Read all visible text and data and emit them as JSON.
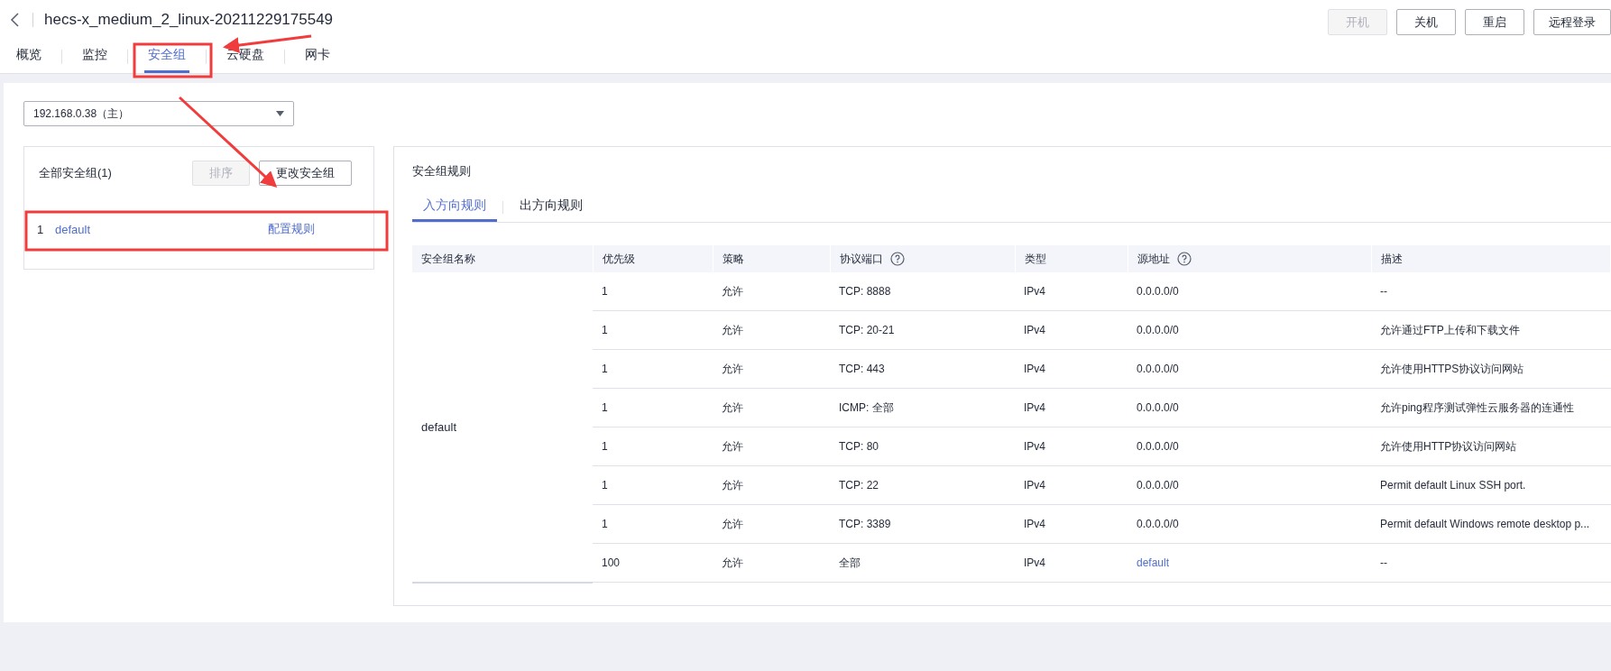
{
  "header": {
    "title": "hecs-x_medium_2_linux-20211229175549",
    "actions": [
      {
        "label": "开机",
        "disabled": true
      },
      {
        "label": "关机",
        "disabled": false
      },
      {
        "label": "重启",
        "disabled": false
      },
      {
        "label": "远程登录",
        "disabled": false
      }
    ]
  },
  "tabs": [
    {
      "label": "概览",
      "selected": false
    },
    {
      "label": "监控",
      "selected": false
    },
    {
      "label": "安全组",
      "selected": true
    },
    {
      "label": "云硬盘",
      "selected": false
    },
    {
      "label": "网卡",
      "selected": false
    }
  ],
  "nic_select": {
    "value": "192.168.0.38（主）"
  },
  "security_groups": {
    "title": "全部安全组(1)",
    "buttons": [
      {
        "label": "排序",
        "disabled": true
      },
      {
        "label": "更改安全组",
        "disabled": false
      }
    ],
    "items": [
      {
        "index": "1",
        "name": "default",
        "action": "配置规则"
      }
    ]
  },
  "rules": {
    "title": "安全组规则",
    "tabs": [
      {
        "label": "入方向规则",
        "selected": true
      },
      {
        "label": "出方向规则",
        "selected": false
      }
    ],
    "table": {
      "columns": [
        {
          "label": "安全组名称",
          "help": false
        },
        {
          "label": "优先级",
          "help": false
        },
        {
          "label": "策略",
          "help": false
        },
        {
          "label": "协议端口",
          "help": true
        },
        {
          "label": "类型",
          "help": false
        },
        {
          "label": "源地址",
          "help": true
        },
        {
          "label": "描述",
          "help": false
        }
      ],
      "group_name": "default",
      "rows": [
        {
          "priority": "1",
          "policy": "允许",
          "port": "TCP: 8888",
          "type": "IPv4",
          "source": "0.0.0.0/0",
          "source_is_link": false,
          "description": "--"
        },
        {
          "priority": "1",
          "policy": "允许",
          "port": "TCP: 20-21",
          "type": "IPv4",
          "source": "0.0.0.0/0",
          "source_is_link": false,
          "description": "允许通过FTP上传和下载文件"
        },
        {
          "priority": "1",
          "policy": "允许",
          "port": "TCP: 443",
          "type": "IPv4",
          "source": "0.0.0.0/0",
          "source_is_link": false,
          "description": "允许使用HTTPS协议访问网站"
        },
        {
          "priority": "1",
          "policy": "允许",
          "port": "ICMP: 全部",
          "type": "IPv4",
          "source": "0.0.0.0/0",
          "source_is_link": false,
          "description": "允许ping程序测试弹性云服务器的连通性"
        },
        {
          "priority": "1",
          "policy": "允许",
          "port": "TCP: 80",
          "type": "IPv4",
          "source": "0.0.0.0/0",
          "source_is_link": false,
          "description": "允许使用HTTP协议访问网站"
        },
        {
          "priority": "1",
          "policy": "允许",
          "port": "TCP: 22",
          "type": "IPv4",
          "source": "0.0.0.0/0",
          "source_is_link": false,
          "description": "Permit default Linux SSH port."
        },
        {
          "priority": "1",
          "policy": "允许",
          "port": "TCP: 3389",
          "type": "IPv4",
          "source": "0.0.0.0/0",
          "source_is_link": false,
          "description": "Permit default Windows remote desktop p..."
        },
        {
          "priority": "100",
          "policy": "允许",
          "port": "全部",
          "type": "IPv4",
          "source": "default",
          "source_is_link": true,
          "description": "--"
        }
      ]
    }
  }
}
